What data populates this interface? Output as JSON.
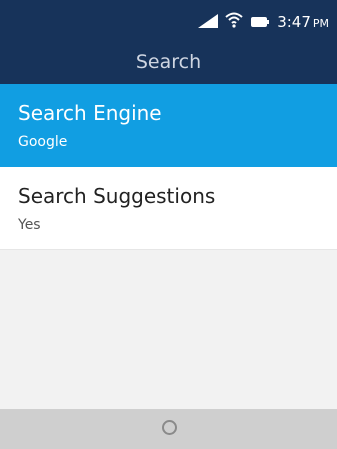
{
  "status_bar": {
    "time": "3:47",
    "ampm": "PM",
    "icons": [
      "signal-icon",
      "wifi-icon",
      "battery-icon"
    ]
  },
  "header": {
    "title": "Search"
  },
  "settings": [
    {
      "title": "Search Engine",
      "value": "Google",
      "selected": true
    },
    {
      "title": "Search Suggestions",
      "value": "Yes",
      "selected": false
    }
  ],
  "softkeys": {
    "center_icon": "circle-icon"
  },
  "colors": {
    "header_bg": "#17335a",
    "selected_bg": "#119ee2",
    "softkey_bg": "#cfcfcf"
  }
}
